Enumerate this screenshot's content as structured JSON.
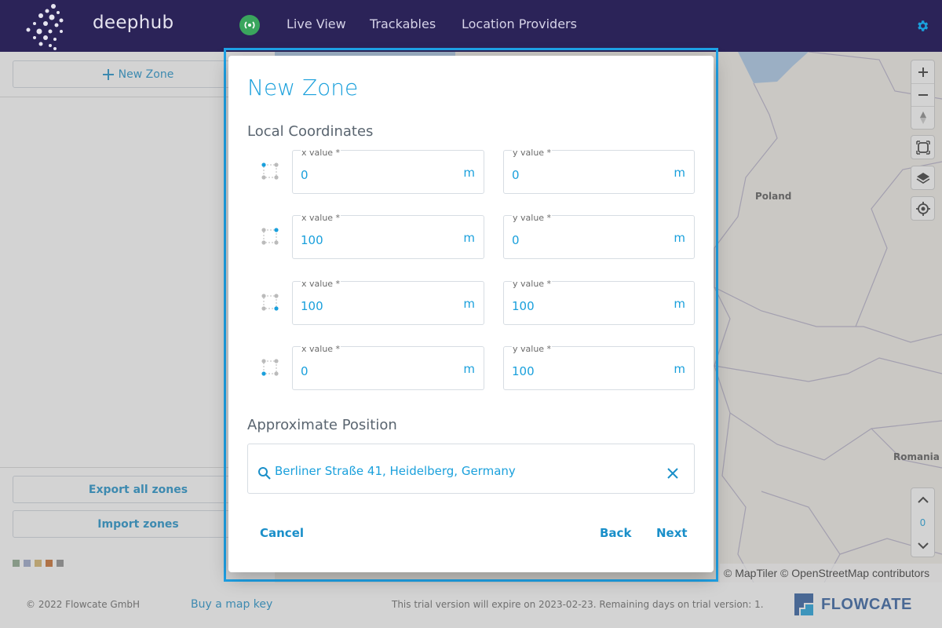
{
  "app": {
    "logo_text": "deephub"
  },
  "nav": {
    "items": [
      {
        "label": "Live View"
      },
      {
        "label": "Trackables"
      },
      {
        "label": "Location Providers"
      }
    ]
  },
  "sidebar": {
    "new_zone_label": "New Zone",
    "export_label": "Export all zones",
    "import_label": "Import zones",
    "swatch_colors": [
      "#8aa68a",
      "#9aa6c9",
      "#d6b46a",
      "#c86a28",
      "#8c8c8c"
    ]
  },
  "map": {
    "labels": {
      "poland": "Poland",
      "romania": "Romania"
    },
    "zoom_level": "0",
    "attribution": "© MapTiler © OpenStreetMap contributors"
  },
  "dialog": {
    "title": "New Zone",
    "local_coordinates_title": "Local Coordinates",
    "approx_position_title": "Approximate Position",
    "unit": "m",
    "x_label": "x value *",
    "y_label": "y value *",
    "points": [
      {
        "x": "0",
        "y": "0",
        "corner": "top-left"
      },
      {
        "x": "100",
        "y": "0",
        "corner": "top-right"
      },
      {
        "x": "100",
        "y": "100",
        "corner": "bottom-right"
      },
      {
        "x": "0",
        "y": "100",
        "corner": "bottom-left"
      }
    ],
    "address_value": "Berliner Straße 41, Heidelberg, Germany",
    "cancel_label": "Cancel",
    "back_label": "Back",
    "next_label": "Next"
  },
  "footer": {
    "copyright": "© 2022 Flowcate GmbH",
    "buy_map_key": "Buy a map key",
    "trial_notice": "This trial version will expire on 2023-02-23. Remaining days on trial version: 1.",
    "brand": "FLOWCATE"
  },
  "colors": {
    "accent": "#1aa0dc",
    "nav_bg": "#2b2358",
    "focus_frame": "#1ea3e8",
    "status_green": "#3aa55d"
  }
}
